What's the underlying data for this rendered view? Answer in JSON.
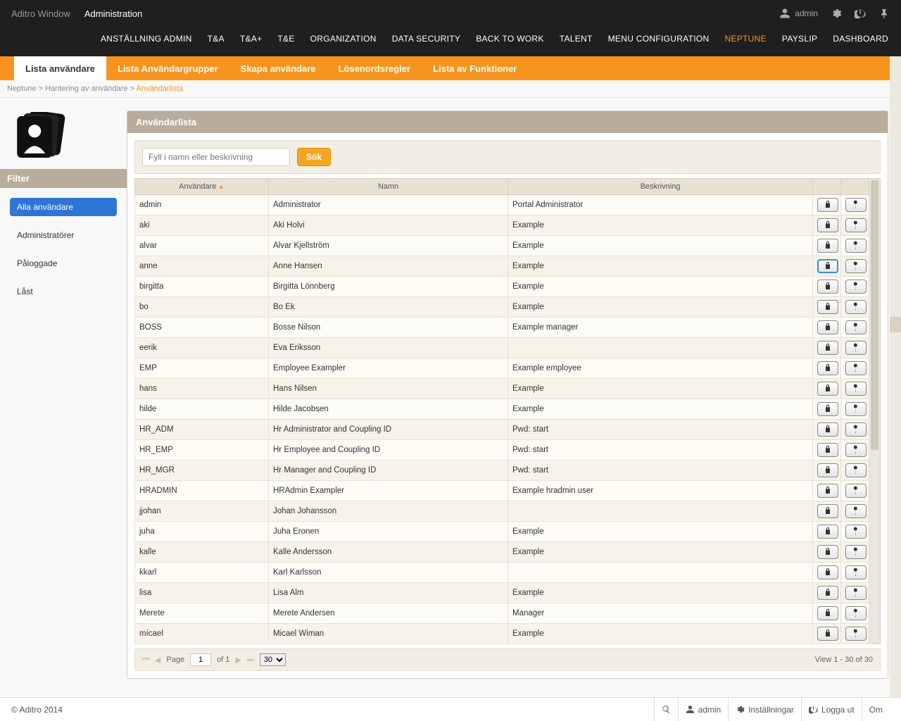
{
  "header": {
    "app_name": "Aditro Window",
    "section": "Administration",
    "user": "admin"
  },
  "top_nav": [
    {
      "label": "ANSTÄLLNING ADMIN",
      "active": false
    },
    {
      "label": "T&A",
      "active": false
    },
    {
      "label": "T&A+",
      "active": false
    },
    {
      "label": "T&E",
      "active": false
    },
    {
      "label": "ORGANIZATION",
      "active": false
    },
    {
      "label": "DATA SECURITY",
      "active": false
    },
    {
      "label": "BACK TO WORK",
      "active": false
    },
    {
      "label": "TALENT",
      "active": false
    },
    {
      "label": "MENU CONFIGURATION",
      "active": false
    },
    {
      "label": "NEPTUNE",
      "active": true
    },
    {
      "label": "PAYSLIP",
      "active": false
    },
    {
      "label": "DASHBOARD",
      "active": false
    }
  ],
  "sub_tabs": [
    {
      "label": "Lista användare",
      "active": true
    },
    {
      "label": "Lista Användargrupper",
      "active": false
    },
    {
      "label": "Skapa användare",
      "active": false
    },
    {
      "label": "Lösenordsregler",
      "active": false
    },
    {
      "label": "Lista av Funktioner",
      "active": false
    }
  ],
  "breadcrumb": {
    "parts": [
      "Neptune",
      "Hantering av användare"
    ],
    "current": "Användarlista"
  },
  "sidebar": {
    "filter_title": "Filter",
    "items": [
      {
        "label": "Alla användare",
        "active": true
      },
      {
        "label": "Administratörer",
        "active": false
      },
      {
        "label": "Påloggade",
        "active": false
      },
      {
        "label": "Låst",
        "active": false
      }
    ]
  },
  "panel": {
    "title": "Användarlista",
    "search_placeholder": "Fyll i namn eller beskrivning",
    "search_button": "Sök",
    "columns": {
      "user": "Användare",
      "name": "Namn",
      "desc": "Beskrivning"
    },
    "rows": [
      {
        "user": "admin",
        "name": "Administrator",
        "desc": "Portal Administrator"
      },
      {
        "user": "aki",
        "name": "Aki Holvi",
        "desc": "Example"
      },
      {
        "user": "alvar",
        "name": "Alvar Kjellström",
        "desc": "Example"
      },
      {
        "user": "anne",
        "name": "Anne Hansen",
        "desc": "Example",
        "selected": true
      },
      {
        "user": "birgitta",
        "name": "Birgitta Lönnberg",
        "desc": "Example"
      },
      {
        "user": "bo",
        "name": "Bo Ek",
        "desc": "Example"
      },
      {
        "user": "BOSS",
        "name": "Bosse Nilson",
        "desc": "Example manager"
      },
      {
        "user": "eerik",
        "name": "Eva Eriksson",
        "desc": ""
      },
      {
        "user": "EMP",
        "name": "Employee Exampler",
        "desc": "Example employee"
      },
      {
        "user": "hans",
        "name": "Hans Nilsen",
        "desc": "Example"
      },
      {
        "user": "hilde",
        "name": "Hilde Jacobsen",
        "desc": "Example"
      },
      {
        "user": "HR_ADM",
        "name": "Hr Administrator and Coupling ID",
        "desc": "Pwd: start"
      },
      {
        "user": "HR_EMP",
        "name": "Hr Employee and Coupling ID",
        "desc": "Pwd: start"
      },
      {
        "user": "HR_MGR",
        "name": "Hr Manager and Coupling ID",
        "desc": "Pwd: start"
      },
      {
        "user": "HRADMIN",
        "name": "HRAdmin Exampler",
        "desc": "Example hradmin user"
      },
      {
        "user": "jjohan",
        "name": "Johan Johansson",
        "desc": ""
      },
      {
        "user": "juha",
        "name": "Juha Eronen",
        "desc": "Example"
      },
      {
        "user": "kalle",
        "name": "Kalle Andersson",
        "desc": "Example"
      },
      {
        "user": "kkarl",
        "name": "Karl Karlsson",
        "desc": ""
      },
      {
        "user": "lisa",
        "name": "Lisa Alm",
        "desc": "Example"
      },
      {
        "user": "Merete",
        "name": "Merete Andersen",
        "desc": "Manager"
      },
      {
        "user": "mícael",
        "name": "Micael Wiman",
        "desc": "Example"
      }
    ],
    "pager": {
      "page_label": "Page",
      "page": "1",
      "of_label": "of 1",
      "page_size": "30",
      "info": "View 1 - 30 of 30"
    }
  },
  "footer": {
    "copyright": "© Aditro 2014",
    "links": {
      "admin": "admin",
      "settings": "Inställningar",
      "logout": "Logga ut",
      "about": "Om"
    }
  }
}
